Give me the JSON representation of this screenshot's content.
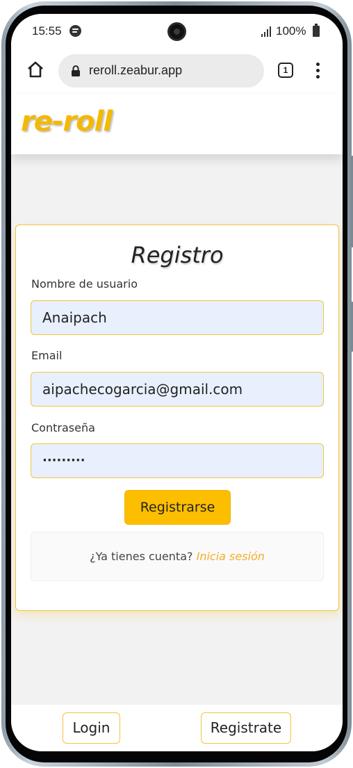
{
  "status_bar": {
    "time": "15:55",
    "battery": "100%",
    "icons": [
      "spotify-icon",
      "front-camera",
      "signal-icon",
      "battery-icon"
    ]
  },
  "browser": {
    "url": "reroll.zeabur.app",
    "tab_count": "1",
    "icons": [
      "home-icon",
      "lock-icon",
      "tabs-icon",
      "more-vert-icon"
    ]
  },
  "app": {
    "logo": "re-roll",
    "brand_color": "#f5b800"
  },
  "form": {
    "title": "Registro",
    "username_label": "Nombre de usuario",
    "username_value": "Anaipach",
    "email_label": "Email",
    "email_value": "aipachecogarcia@gmail.com",
    "password_label": "Contraseña",
    "password_value": "·········",
    "submit_label": "Registrarse",
    "login_prompt": "¿Ya tienes cuenta?",
    "login_link": "Inicia sesión",
    "input_bg": "#e8f0fe",
    "button_color": "#fdbe00"
  },
  "bottom_nav": {
    "login": "Login",
    "register": "Registrate"
  }
}
